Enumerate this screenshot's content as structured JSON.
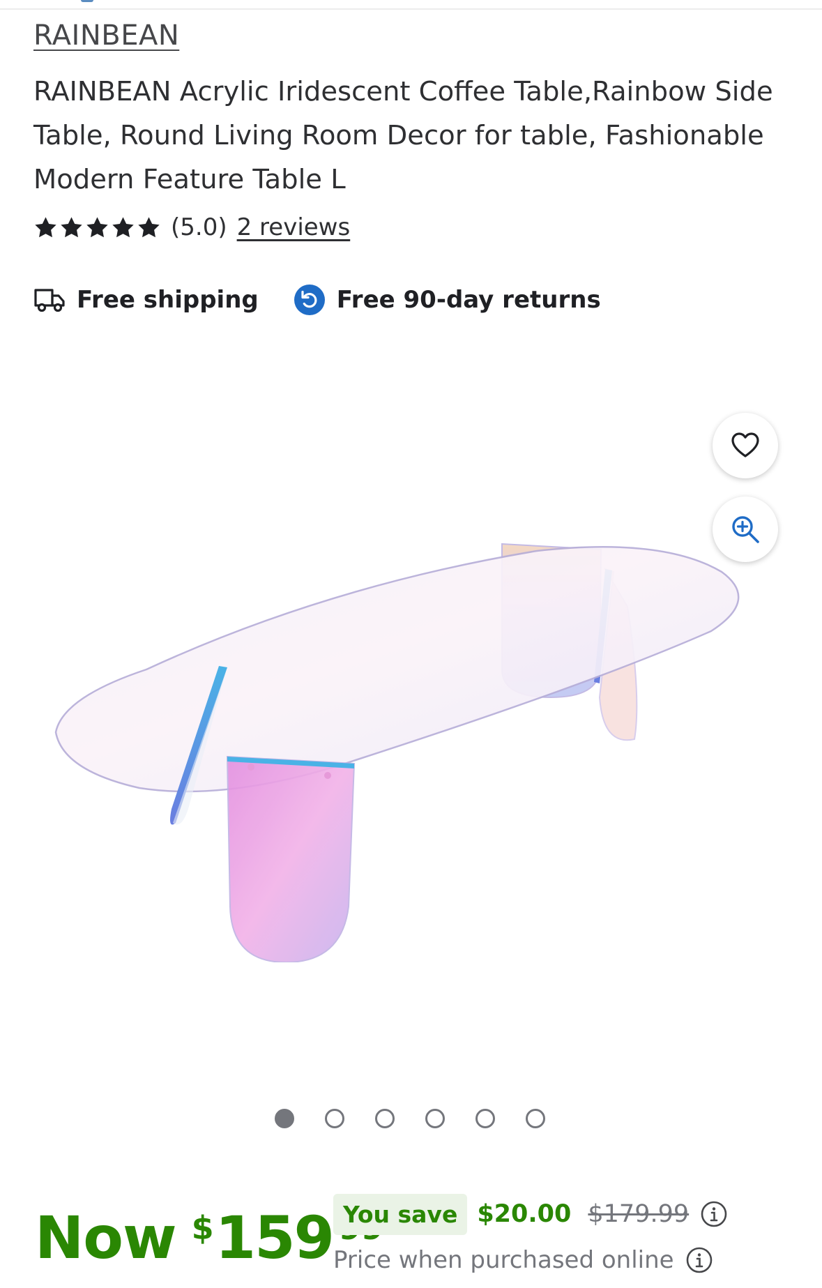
{
  "product": {
    "brand": "RAINBEAN",
    "title": "RAINBEAN Acrylic Iridescent Coffee Table,Rainbow Side Table, Round Living Room Decor for table, Fashionable Modern Feature Table L",
    "rating": {
      "stars": 5,
      "value_label": "(5.0)",
      "reviews_label": "2 reviews"
    }
  },
  "badges": {
    "shipping": {
      "label": "Free shipping",
      "icon": "truck-icon"
    },
    "returns": {
      "label": "Free 90-day returns",
      "icon": "returns-icon",
      "color": "#1f6cc6"
    }
  },
  "gallery": {
    "image_count": 6,
    "active_index": 0,
    "actions": [
      "heart-icon",
      "zoom-in-icon"
    ],
    "accent_color": "#1f6cc6"
  },
  "price": {
    "now_label": "Now",
    "currency": "$",
    "dollars": "159",
    "cents": "99",
    "you_save_label": "You save",
    "save_amount": "$20.00",
    "was_price": "$179.99",
    "online_note": "Price when purchased online",
    "color": "#2a8703"
  }
}
